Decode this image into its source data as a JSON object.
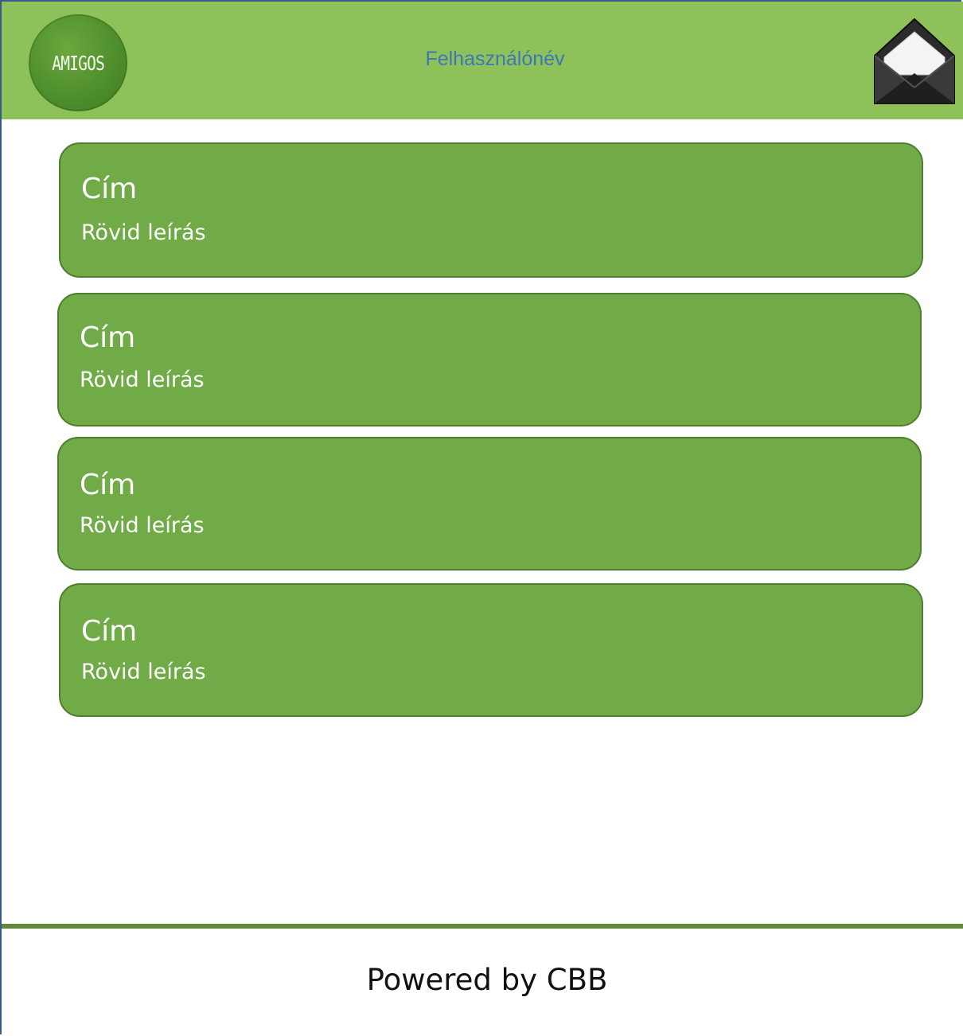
{
  "header": {
    "logo_text": "AMIGOS",
    "username": "Felhasználónév",
    "mail_icon": "envelope-icon",
    "background_color": "#8fc15b"
  },
  "cards": [
    {
      "title": "Cím",
      "description": "Rövid leírás"
    },
    {
      "title": "Cím",
      "description": "Rövid leírás"
    },
    {
      "title": "Cím",
      "description": "Rövid leírás"
    },
    {
      "title": "Cím",
      "description": "Rövid leírás"
    }
  ],
  "card_color": "#70ab47",
  "footer": {
    "text": "Powered by CBB"
  }
}
